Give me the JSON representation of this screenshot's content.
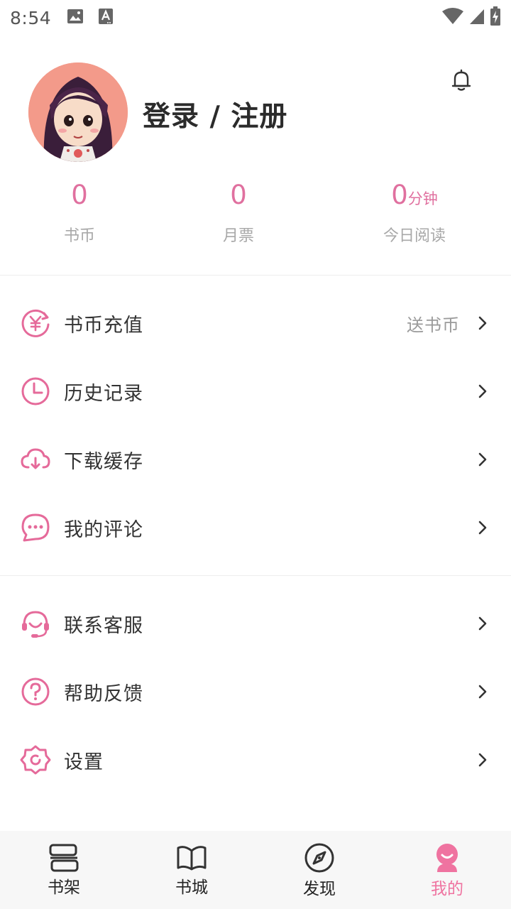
{
  "status_bar": {
    "time": "8:54",
    "icons": [
      "image-notification-icon",
      "accessibility-notification-icon",
      "wifi-icon",
      "cellular-signal-icon",
      "battery-charging-icon"
    ]
  },
  "profile": {
    "login_label": "登录 / 注册",
    "stats": [
      {
        "value": "0",
        "unit": "",
        "label": "书币"
      },
      {
        "value": "0",
        "unit": "",
        "label": "月票"
      },
      {
        "value": "0",
        "unit": "分钟",
        "label": "今日阅读"
      }
    ]
  },
  "menu_group_1": [
    {
      "label": "书币充值",
      "extra": "送书币",
      "icon": "coin-recharge-icon"
    },
    {
      "label": "历史记录",
      "extra": "",
      "icon": "clock-icon"
    },
    {
      "label": "下载缓存",
      "extra": "",
      "icon": "cloud-download-icon"
    },
    {
      "label": "我的评论",
      "extra": "",
      "icon": "comment-icon"
    }
  ],
  "menu_group_2": [
    {
      "label": "联系客服",
      "extra": "",
      "icon": "headset-icon"
    },
    {
      "label": "帮助反馈",
      "extra": "",
      "icon": "help-icon"
    },
    {
      "label": "设置",
      "extra": "",
      "icon": "settings-icon"
    }
  ],
  "bottom_nav": {
    "items": [
      {
        "label": "书架",
        "icon": "bookshelf-icon"
      },
      {
        "label": "书城",
        "icon": "open-book-icon"
      },
      {
        "label": "发现",
        "icon": "compass-icon"
      },
      {
        "label": "我的",
        "icon": "profile-icon"
      }
    ],
    "active_index": 3
  },
  "colors": {
    "accent": "#e0709f",
    "icon_accent": "#e56a9a",
    "nav_active": "#ef73a0",
    "text_primary": "#333333",
    "text_secondary": "#a8a8a8"
  }
}
